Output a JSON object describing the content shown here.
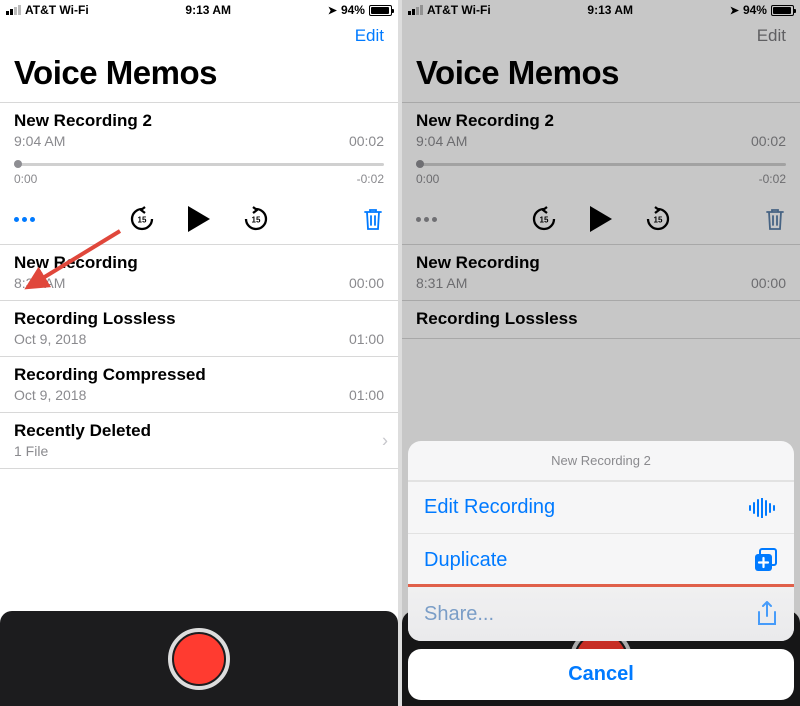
{
  "status": {
    "carrier": "AT&T Wi-Fi",
    "time": "9:13 AM",
    "battery": "94%"
  },
  "nav": {
    "edit": "Edit"
  },
  "title": "Voice Memos",
  "player": {
    "name": "New Recording 2",
    "time": "9:04 AM",
    "duration": "00:02",
    "pos": "0:00",
    "remaining": "-0:02"
  },
  "list": [
    {
      "name": "New Recording",
      "sub": "8:31 AM",
      "dur": "00:00"
    },
    {
      "name": "Recording Lossless",
      "sub": "Oct 9, 2018",
      "dur": "01:00"
    },
    {
      "name": "Recording Compressed",
      "sub": "Oct 9, 2018",
      "dur": "01:00"
    },
    {
      "name": "Recently Deleted",
      "sub": "1 File",
      "dur": "",
      "chevron": true
    }
  ],
  "sheet": {
    "title": "New Recording 2",
    "opts": [
      {
        "label": "Edit Recording"
      },
      {
        "label": "Duplicate"
      },
      {
        "label": "Share..."
      }
    ],
    "cancel": "Cancel"
  },
  "icons": {
    "skipback": "15",
    "skipfwd": "15"
  }
}
